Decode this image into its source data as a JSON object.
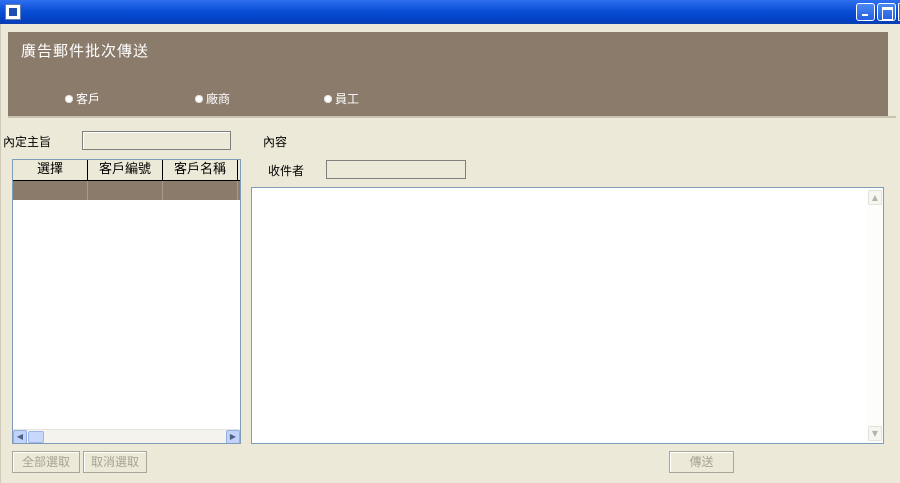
{
  "window": {
    "app_icon": "app-window-icon",
    "controls": [
      "minimize-icon",
      "maximize-icon",
      "close-icon"
    ]
  },
  "header": {
    "title": "廣告郵件批次傳送",
    "recipient_types": [
      {
        "label": "客戶",
        "selected": true
      },
      {
        "label": "廠商",
        "selected": false
      },
      {
        "label": "員工",
        "selected": false
      }
    ]
  },
  "form": {
    "subject_label": "內定主旨",
    "subject_value": "",
    "content_label": "內容",
    "recipient_label": "收件者",
    "recipient_value": "",
    "content_value": ""
  },
  "grid": {
    "columns": [
      "選擇",
      "客戶編號",
      "客戶名稱"
    ],
    "rows": [
      [
        "",
        "",
        ""
      ]
    ]
  },
  "buttons": {
    "select_all": "全部選取",
    "cancel_select": "取消選取",
    "send": "傳送"
  },
  "colors": {
    "header_band": "#8a7b6b",
    "title_bar": "#0a4fd6"
  }
}
